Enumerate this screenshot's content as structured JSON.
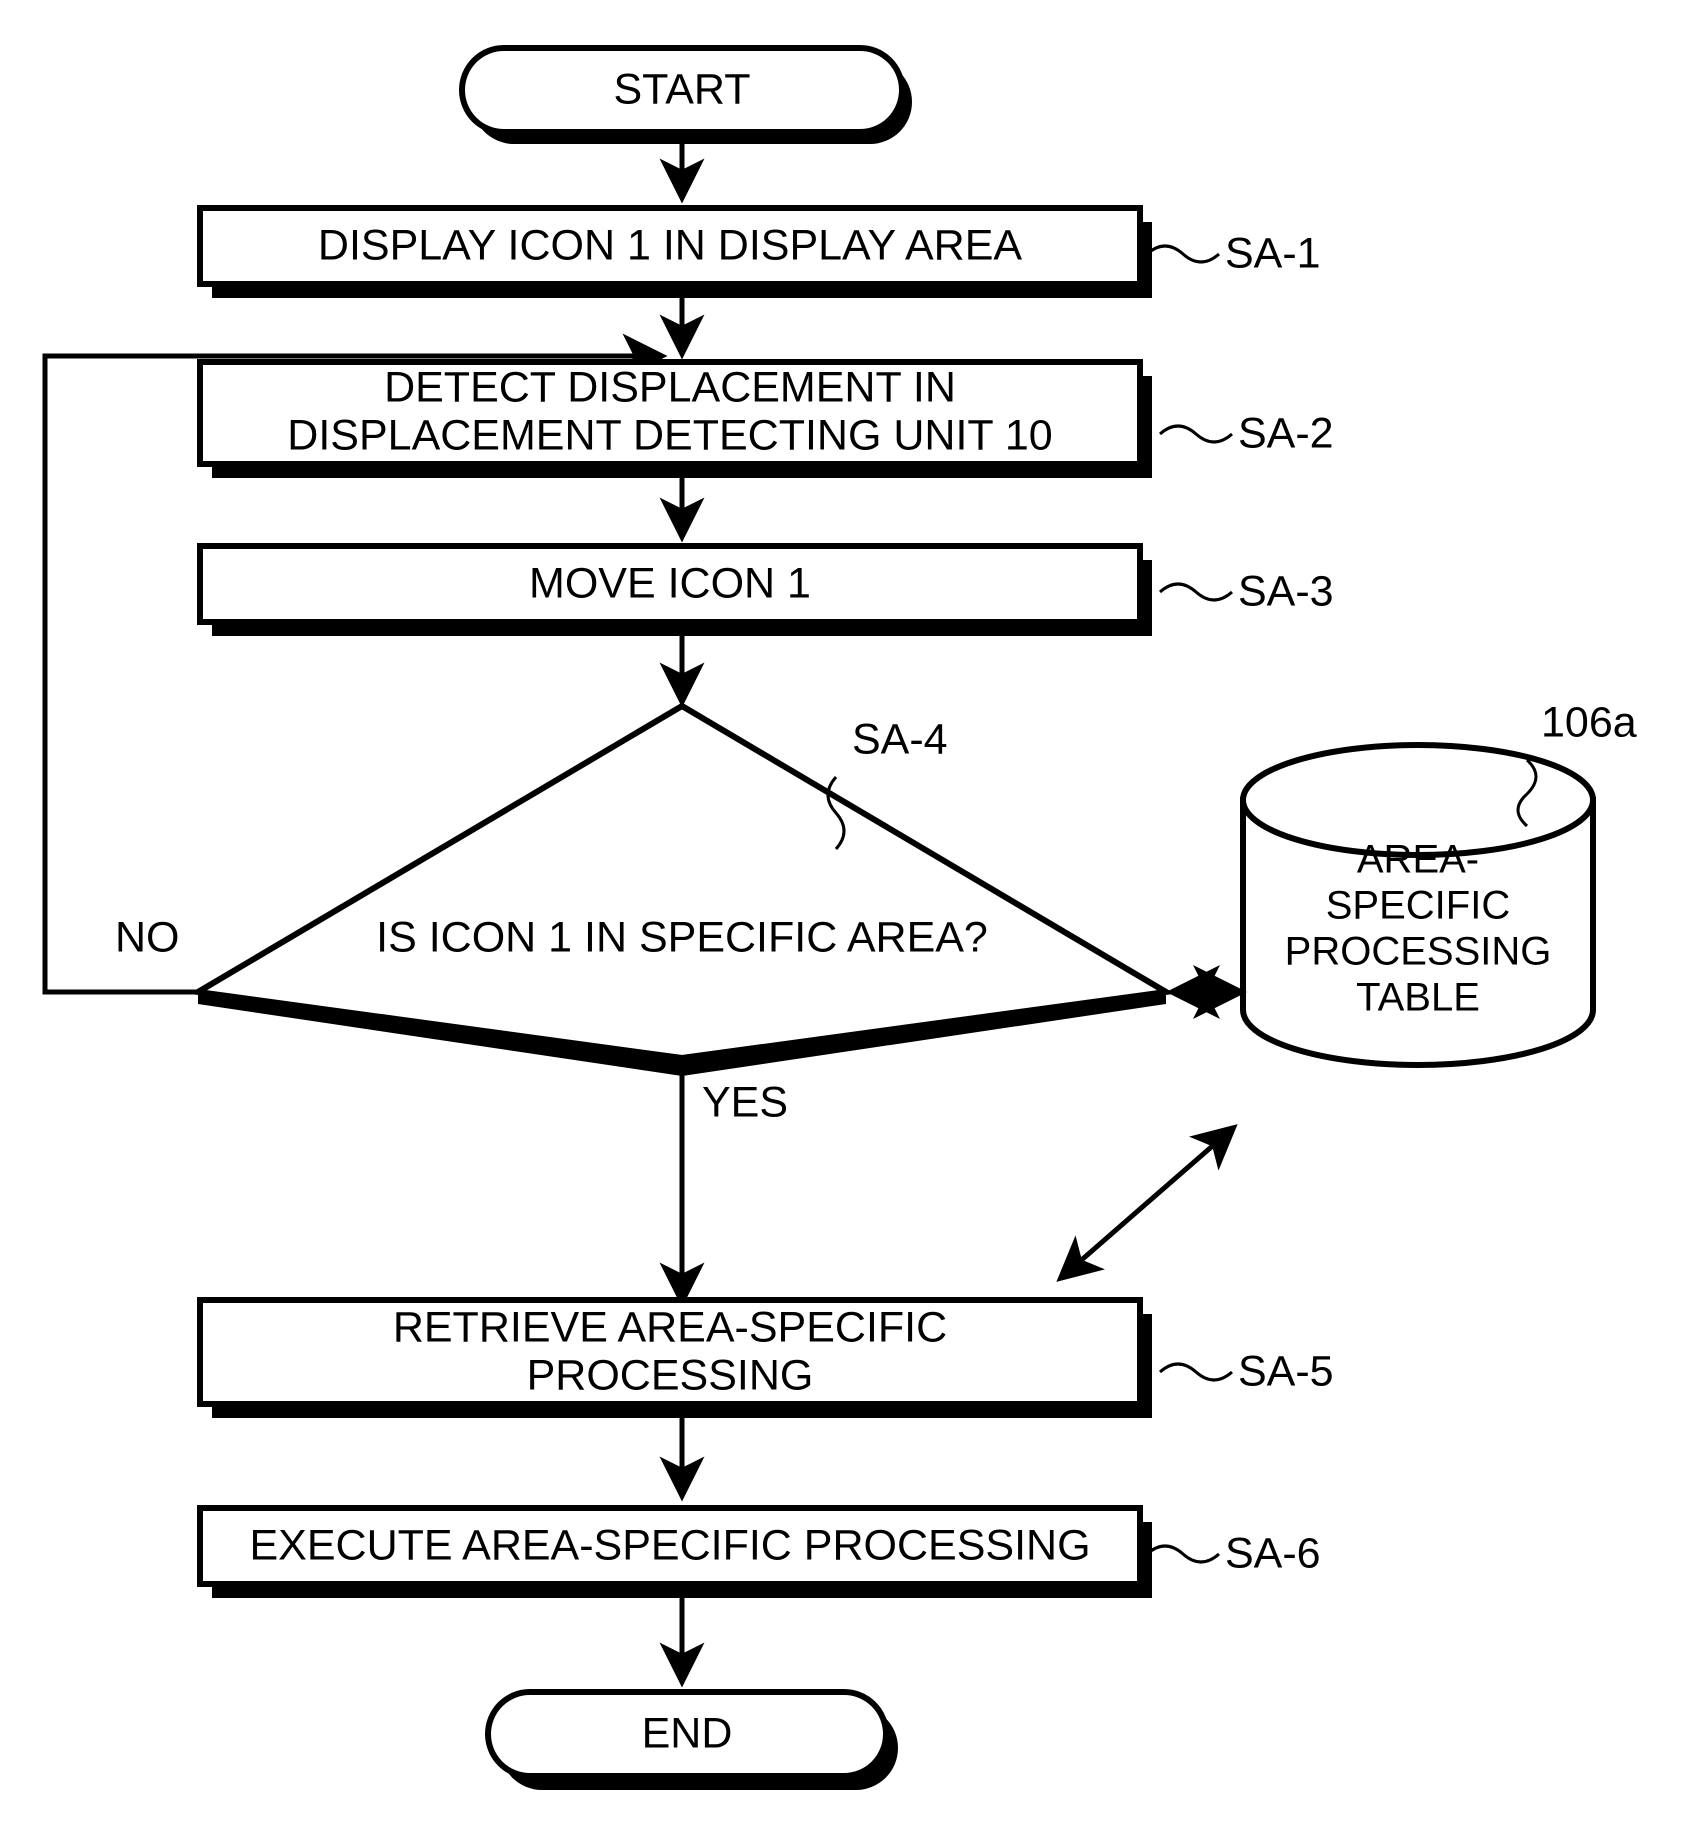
{
  "diagram": {
    "title": "Flowchart for area-specific processing of icon displacement",
    "nodes": {
      "start": {
        "label": "START",
        "shape": "terminator"
      },
      "sa1": {
        "label": "DISPLAY ICON 1 IN DISPLAY AREA",
        "ref": "SA-1",
        "shape": "process"
      },
      "sa2": {
        "line1": "DETECT DISPLACEMENT IN",
        "line2": "DISPLACEMENT DETECTING UNIT 10",
        "ref": "SA-2",
        "shape": "process"
      },
      "sa3": {
        "label": "MOVE ICON 1",
        "ref": "SA-3",
        "shape": "process"
      },
      "sa4": {
        "label": "IS ICON 1 IN SPECIFIC AREA?",
        "ref": "SA-4",
        "shape": "decision"
      },
      "sa5": {
        "line1": "RETRIEVE AREA-SPECIFIC",
        "line2": "PROCESSING",
        "ref": "SA-5",
        "shape": "process"
      },
      "sa6": {
        "label": "EXECUTE AREA-SPECIFIC PROCESSING",
        "ref": "SA-6",
        "shape": "process"
      },
      "end": {
        "label": "END",
        "shape": "terminator"
      },
      "db": {
        "line1": "AREA-",
        "line2": "SPECIFIC",
        "line3": "PROCESSING",
        "line4": "TABLE",
        "ref": "106a",
        "shape": "database"
      }
    },
    "edge_labels": {
      "no": "NO",
      "yes": "YES"
    },
    "colors": {
      "stroke": "#000000",
      "fill": "#ffffff",
      "shadow": "#000000"
    }
  }
}
